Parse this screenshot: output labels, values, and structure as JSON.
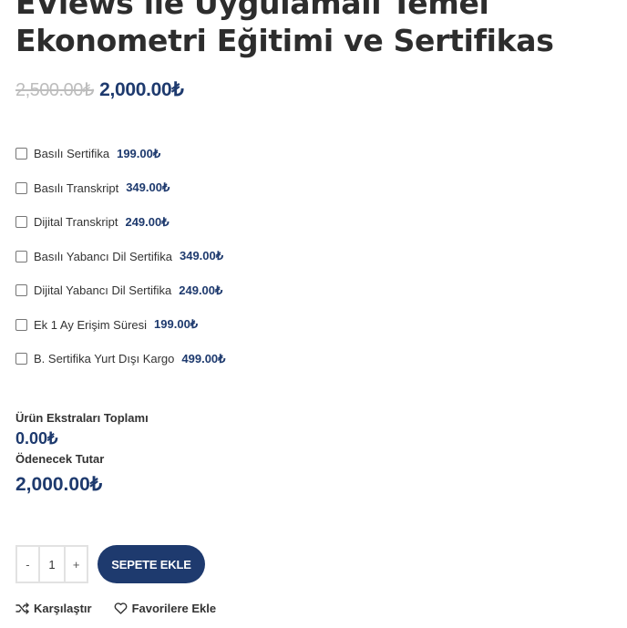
{
  "product": {
    "title": "EViews ile Uygulamalı Temel Ekonometri Eğitimi ve Sertifikas",
    "old_price": "2,500.00₺",
    "price": "2,000.00₺"
  },
  "options": [
    {
      "label": "Basılı Sertifika",
      "price": "199.00₺"
    },
    {
      "label": "Basılı Transkript",
      "price": "349.00₺"
    },
    {
      "label": "Dijital Transkript",
      "price": "249.00₺"
    },
    {
      "label": "Basılı Yabancı Dil Sertifika",
      "price": "349.00₺"
    },
    {
      "label": "Dijital Yabancı Dil Sertifika",
      "price": "249.00₺"
    },
    {
      "label": "Ek 1 Ay Erişim Süresi",
      "price": "199.00₺"
    },
    {
      "label": "B. Sertifika Yurt Dışı Kargo",
      "price": "499.00₺"
    }
  ],
  "totals": {
    "extras_label": "Ürün Ekstraları Toplamı",
    "extras_value": "0.00₺",
    "payable_label": "Ödenecek Tutar",
    "payable_value": "2,000.00₺"
  },
  "quantity": {
    "minus": "-",
    "value": "1",
    "plus": "+"
  },
  "actions": {
    "add_to_cart": "SEPETE EKLE",
    "compare": "Karşılaştır",
    "wishlist": "Favorilere Ekle"
  },
  "colors": {
    "accent": "#1e3a6e",
    "old_price": "#bdbdbd"
  }
}
